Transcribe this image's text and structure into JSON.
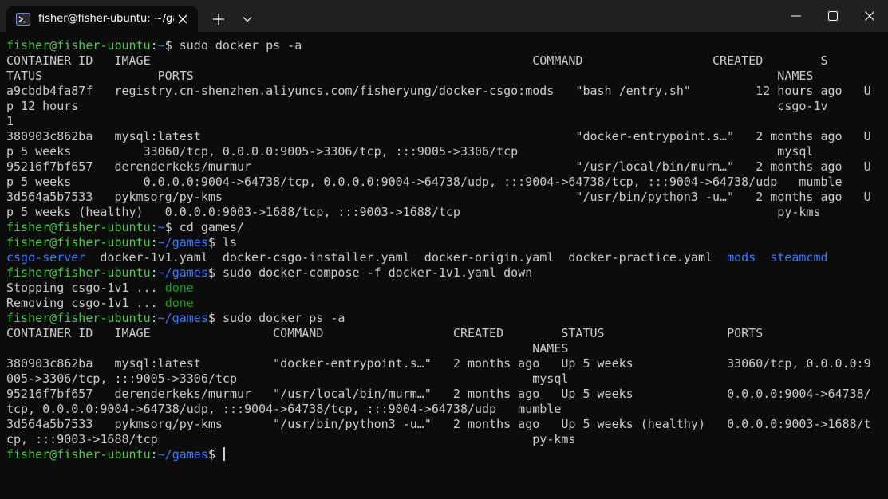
{
  "window": {
    "tab_title": "fisher@fisher-ubuntu: ~/game",
    "tab_icon": "terminal-icon",
    "buttons": [
      "new-tab-icon",
      "dropdown-chevron-icon",
      "minimize-icon",
      "maximize-icon",
      "close-icon"
    ]
  },
  "colors": {
    "background": "#0c0c0c",
    "titlebar": "#202020",
    "prompt_user": "#4ec94e",
    "prompt_path": "#3b78ff",
    "text": "#cccccc",
    "done": "#13a10e"
  },
  "prompt": {
    "user": "fisher@fisher-ubuntu",
    "colon": ":",
    "home": "~",
    "games": "~/games",
    "dollar": "$ "
  },
  "terminal": {
    "cmd1": "sudo docker ps -a",
    "ps1_header1": "CONTAINER ID   IMAGE                                                     COMMAND                  CREATED        S",
    "ps1_header2": "TATUS                PORTS                                                                                 NAMES",
    "ps1_r1a": "a9cbdb4fa87f   registry.cn-shenzhen.aliyuncs.com/fisheryung/docker-csgo:mods   \"bash /entry.sh\"         12 hours ago   U",
    "ps1_r1b": "p 12 hours                                                                                                 csgo-1v",
    "ps1_r1c": "1",
    "ps1_r2a": "380903c862ba   mysql:latest                                                    \"docker-entrypoint.s…\"   2 months ago   U",
    "ps1_r2b": "p 5 weeks          33060/tcp, 0.0.0.0:9005->3306/tcp, :::9005->3306/tcp                                    mysql",
    "ps1_r3a": "95216f7bf657   derenderkeks/murmur                                             \"/usr/local/bin/murm…\"   2 months ago   U",
    "ps1_r3b": "p 5 weeks          0.0.0.0:9004->64738/tcp, 0.0.0.0:9004->64738/udp, :::9004->64738/tcp, :::9004->64738/udp   mumble",
    "ps1_r4a": "3d564a5b7533   pykmsorg/py-kms                                                 \"/usr/bin/python3 -u…\"   2 months ago   U",
    "ps1_r4b": "p 5 weeks (healthy)   0.0.0.0:9003->1688/tcp, :::9003->1688/tcp                                            py-kms",
    "cmd2": "cd games/",
    "cmd3": "ls",
    "ls_csgo_server": "csgo-server",
    "ls_files": "  docker-1v1.yaml  docker-csgo-installer.yaml  docker-origin.yaml  docker-practice.yaml  ",
    "ls_mods": "mods",
    "ls_sep": "  ",
    "ls_steamcmd": "steamcmd",
    "cmd4": "sudo docker-compose -f docker-1v1.yaml down",
    "stop_text": "Stopping csgo-1v1 ... ",
    "remove_text": "Removing csgo-1v1 ... ",
    "done_label": "done",
    "cmd5": "sudo docker ps -a",
    "ps2_header1": "CONTAINER ID   IMAGE                 COMMAND                  CREATED        STATUS                 PORTS",
    "ps2_header2": "                                                                         NAMES",
    "ps2_r1a": "380903c862ba   mysql:latest          \"docker-entrypoint.s…\"   2 months ago   Up 5 weeks             33060/tcp, 0.0.0.0:9",
    "ps2_r1b": "005->3306/tcp, :::9005->3306/tcp                                         mysql",
    "ps2_r2a": "95216f7bf657   derenderkeks/murmur   \"/usr/local/bin/murm…\"   2 months ago   Up 5 weeks             0.0.0.0:9004->64738/",
    "ps2_r2b": "tcp, 0.0.0.0:9004->64738/udp, :::9004->64738/tcp, :::9004->64738/udp   mumble",
    "ps2_r3a": "3d564a5b7533   pykmsorg/py-kms       \"/usr/bin/python3 -u…\"   2 months ago   Up 5 weeks (healthy)   0.0.0.0:9003->1688/t",
    "ps2_r3b": "cp, :::9003->1688/tcp                                                    py-kms"
  }
}
